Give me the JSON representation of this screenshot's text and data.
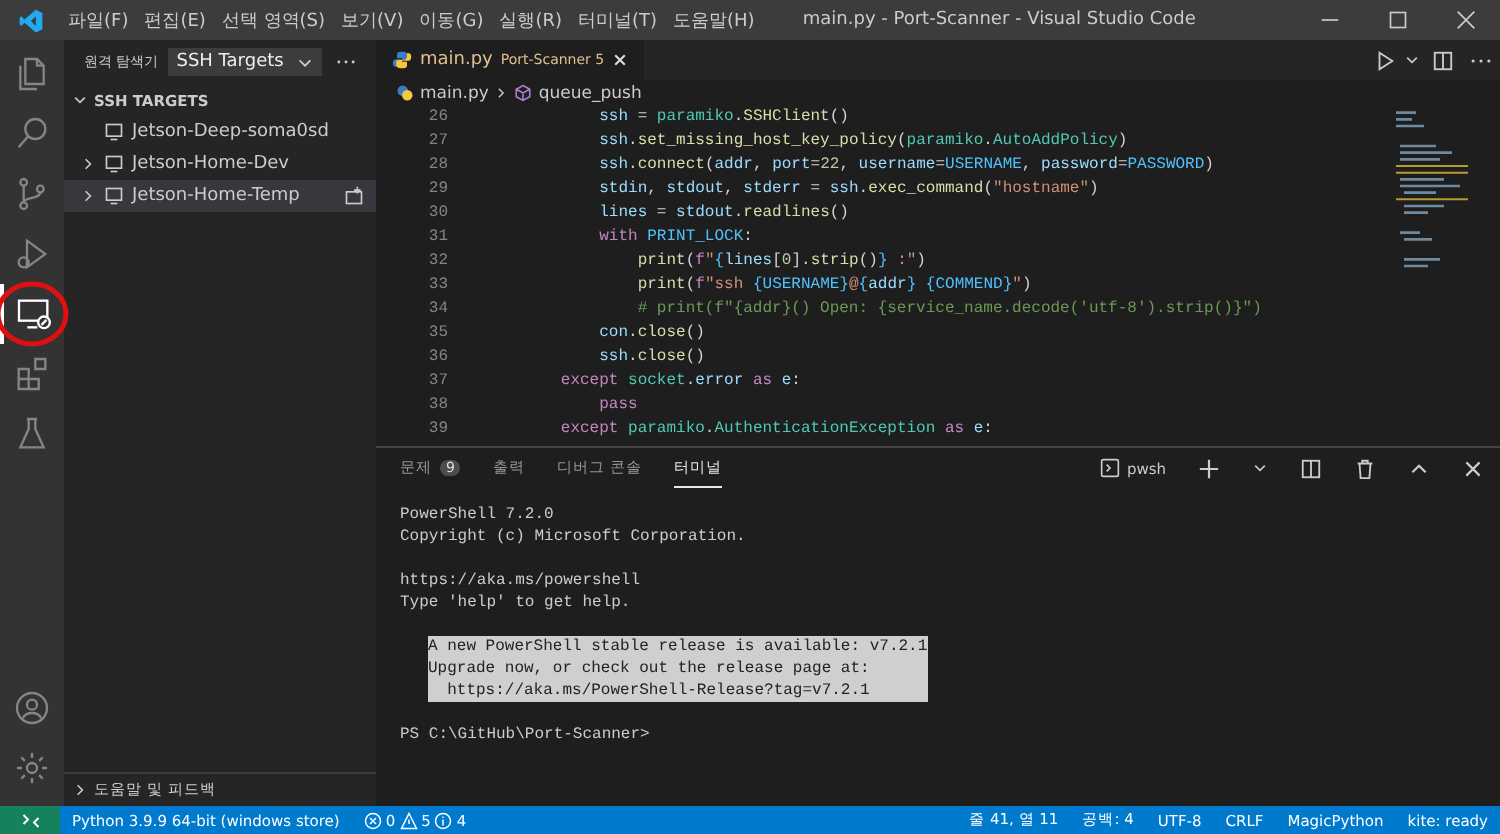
{
  "window": {
    "title": "main.py - Port-Scanner - Visual Studio Code"
  },
  "menu": [
    "파일(F)",
    "편집(E)",
    "선택 영역(S)",
    "보기(V)",
    "이동(G)",
    "실행(R)",
    "터미널(T)",
    "도움말(H)"
  ],
  "activity_bar": {
    "top": [
      {
        "kind": "files",
        "selected": false
      },
      {
        "kind": "search",
        "selected": false
      },
      {
        "kind": "source-control",
        "selected": false
      },
      {
        "kind": "run-debug",
        "selected": false
      },
      {
        "kind": "remote",
        "selected": true,
        "circled": true
      },
      {
        "kind": "extensions",
        "selected": false
      },
      {
        "kind": "testing",
        "selected": false
      }
    ],
    "bottom": [
      {
        "kind": "account",
        "selected": false
      },
      {
        "kind": "settings",
        "selected": false
      }
    ]
  },
  "sidebar": {
    "title": "원격 탐색기",
    "dropdown": "SSH Targets",
    "section": {
      "title": "SSH TARGETS",
      "expanded": true
    },
    "items": [
      {
        "label": "Jetson-Deep-soma0sd",
        "expandable": false,
        "selected": false
      },
      {
        "label": "Jetson-Home-Dev",
        "expandable": true,
        "selected": false
      },
      {
        "label": "Jetson-Home-Temp",
        "expandable": true,
        "selected": true
      }
    ],
    "footer": {
      "title": "도움말 및 피드백",
      "expanded": false
    }
  },
  "editor": {
    "tab": {
      "file": "main.py",
      "folder": "Port-Scanner",
      "problems": "5"
    },
    "breadcrumb": [
      "main.py",
      "queue_push"
    ],
    "lines": [
      {
        "number": "26",
        "tokens": [
          {
            "kind": "var",
            "text": "            ssh"
          },
          {
            "kind": "plain",
            "text": " = "
          },
          {
            "kind": "class",
            "text": "paramiko"
          },
          {
            "kind": "plain",
            "text": "."
          },
          {
            "kind": "fn",
            "text": "SSHClient"
          },
          {
            "kind": "plain",
            "text": "()"
          }
        ]
      },
      {
        "number": "27",
        "tokens": [
          {
            "kind": "var",
            "text": "            ssh"
          },
          {
            "kind": "plain",
            "text": "."
          },
          {
            "kind": "fn",
            "text": "set_missing_host_key_policy"
          },
          {
            "kind": "plain",
            "text": "("
          },
          {
            "kind": "class",
            "text": "paramiko"
          },
          {
            "kind": "plain",
            "text": "."
          },
          {
            "kind": "class",
            "text": "AutoAddPolicy"
          },
          {
            "kind": "plain",
            "text": ")"
          }
        ]
      },
      {
        "number": "28",
        "tokens": [
          {
            "kind": "var",
            "text": "            ssh"
          },
          {
            "kind": "plain",
            "text": "."
          },
          {
            "kind": "fn",
            "text": "connect"
          },
          {
            "kind": "plain",
            "text": "("
          },
          {
            "kind": "var",
            "text": "addr"
          },
          {
            "kind": "plain",
            "text": ", "
          },
          {
            "kind": "var",
            "text": "port"
          },
          {
            "kind": "plain",
            "text": "="
          },
          {
            "kind": "num",
            "text": "22"
          },
          {
            "kind": "plain",
            "text": ", "
          },
          {
            "kind": "var",
            "text": "username"
          },
          {
            "kind": "plain",
            "text": "="
          },
          {
            "kind": "const",
            "text": "USERNAME"
          },
          {
            "kind": "plain",
            "text": ", "
          },
          {
            "kind": "var",
            "text": "password"
          },
          {
            "kind": "plain",
            "text": "="
          },
          {
            "kind": "const",
            "text": "PASSWORD"
          },
          {
            "kind": "plain",
            "text": ")"
          }
        ]
      },
      {
        "number": "29",
        "tokens": [
          {
            "kind": "var",
            "text": "            stdin"
          },
          {
            "kind": "plain",
            "text": ", "
          },
          {
            "kind": "var",
            "text": "stdout"
          },
          {
            "kind": "plain",
            "text": ", "
          },
          {
            "kind": "var",
            "text": "stderr"
          },
          {
            "kind": "plain",
            "text": " = "
          },
          {
            "kind": "var",
            "text": "ssh"
          },
          {
            "kind": "plain",
            "text": "."
          },
          {
            "kind": "fn",
            "text": "exec_command"
          },
          {
            "kind": "plain",
            "text": "("
          },
          {
            "kind": "str",
            "text": "\"hostname\""
          },
          {
            "kind": "plain",
            "text": ")"
          }
        ]
      },
      {
        "number": "30",
        "tokens": [
          {
            "kind": "var",
            "text": "            lines"
          },
          {
            "kind": "plain",
            "text": " = "
          },
          {
            "kind": "var",
            "text": "stdout"
          },
          {
            "kind": "plain",
            "text": "."
          },
          {
            "kind": "fn",
            "text": "readlines"
          },
          {
            "kind": "plain",
            "text": "()"
          }
        ]
      },
      {
        "number": "31",
        "tokens": [
          {
            "kind": "kw",
            "text": "            with "
          },
          {
            "kind": "const",
            "text": "PRINT_LOCK"
          },
          {
            "kind": "plain",
            "text": ":"
          }
        ]
      },
      {
        "number": "32",
        "tokens": [
          {
            "kind": "fn",
            "text": "                print"
          },
          {
            "kind": "plain",
            "text": "("
          },
          {
            "kind": "kw",
            "text": "f"
          },
          {
            "kind": "str",
            "text": "\""
          },
          {
            "kind": "const",
            "text": "{"
          },
          {
            "kind": "var",
            "text": "lines"
          },
          {
            "kind": "plain",
            "text": "["
          },
          {
            "kind": "num",
            "text": "0"
          },
          {
            "kind": "plain",
            "text": "]."
          },
          {
            "kind": "fn",
            "text": "strip"
          },
          {
            "kind": "plain",
            "text": "()"
          },
          {
            "kind": "const",
            "text": "}"
          },
          {
            "kind": "str",
            "text": " :\""
          },
          {
            "kind": "plain",
            "text": ")"
          }
        ]
      },
      {
        "number": "33",
        "tokens": [
          {
            "kind": "fn",
            "text": "                print"
          },
          {
            "kind": "plain",
            "text": "("
          },
          {
            "kind": "kw",
            "text": "f"
          },
          {
            "kind": "str",
            "text": "\"ssh "
          },
          {
            "kind": "const",
            "text": "{USERNAME}"
          },
          {
            "kind": "str",
            "text": "@"
          },
          {
            "kind": "const",
            "text": "{"
          },
          {
            "kind": "var",
            "text": "addr"
          },
          {
            "kind": "const",
            "text": "} "
          },
          {
            "kind": "const",
            "text": "{COMMEND}"
          },
          {
            "kind": "str",
            "text": "\""
          },
          {
            "kind": "plain",
            "text": ")"
          }
        ]
      },
      {
        "number": "34",
        "tokens": [
          {
            "kind": "comment",
            "text": "                # print(f\"{addr}() Open: {service_name.decode('utf-8').strip()}\")"
          }
        ]
      },
      {
        "number": "35",
        "tokens": [
          {
            "kind": "var",
            "text": "            con"
          },
          {
            "kind": "plain",
            "text": "."
          },
          {
            "kind": "fn",
            "text": "close"
          },
          {
            "kind": "plain",
            "text": "()"
          }
        ]
      },
      {
        "number": "36",
        "tokens": [
          {
            "kind": "var",
            "text": "            ssh"
          },
          {
            "kind": "plain",
            "text": "."
          },
          {
            "kind": "fn",
            "text": "close"
          },
          {
            "kind": "plain",
            "text": "()"
          }
        ]
      },
      {
        "number": "37",
        "tokens": [
          {
            "kind": "kw",
            "text": "        except "
          },
          {
            "kind": "class",
            "text": "socket"
          },
          {
            "kind": "plain",
            "text": "."
          },
          {
            "kind": "var",
            "text": "error "
          },
          {
            "kind": "kw",
            "text": "as "
          },
          {
            "kind": "var",
            "text": "e"
          },
          {
            "kind": "plain",
            "text": ":"
          }
        ]
      },
      {
        "number": "38",
        "tokens": [
          {
            "kind": "kw",
            "text": "            pass"
          }
        ]
      },
      {
        "number": "39",
        "tokens": [
          {
            "kind": "kw",
            "text": "        except "
          },
          {
            "kind": "class",
            "text": "paramiko"
          },
          {
            "kind": "plain",
            "text": "."
          },
          {
            "kind": "class",
            "text": "AuthenticationException "
          },
          {
            "kind": "kw",
            "text": "as "
          },
          {
            "kind": "var",
            "text": "e"
          },
          {
            "kind": "plain",
            "text": ":"
          }
        ]
      }
    ]
  },
  "panel": {
    "tabs": [
      {
        "label": "문제",
        "badge": "9",
        "selected": false
      },
      {
        "label": "출력",
        "selected": false
      },
      {
        "label": "디버그 콘솔",
        "selected": false
      },
      {
        "label": "터미널",
        "selected": true
      }
    ],
    "shell": "pwsh",
    "terminal": [
      {
        "highlighted": false,
        "lines": [
          "PowerShell 7.2.0",
          "Copyright (c) Microsoft Corporation."
        ]
      },
      {
        "highlighted": false,
        "lines": [
          "https://aka.ms/powershell",
          "Type 'help' to get help."
        ]
      },
      {
        "highlighted": true,
        "lines": [
          "A new PowerShell stable release is available: v7.2.1",
          "Upgrade now, or check out the release page at:",
          "  https://aka.ms/PowerShell-Release?tag=v7.2.1"
        ]
      },
      {
        "highlighted": false,
        "lines": [
          "PS C:\\GitHub\\Port-Scanner>"
        ]
      }
    ]
  },
  "status_bar": {
    "interpreter": "Python 3.9.9 64-bit (windows store)",
    "errors": "0",
    "warnings": "5",
    "infos": "4",
    "right": [
      "줄 41, 열 11",
      "공백: 4",
      "UTF-8",
      "CRLF",
      "MagicPython",
      "kite: ready"
    ]
  }
}
